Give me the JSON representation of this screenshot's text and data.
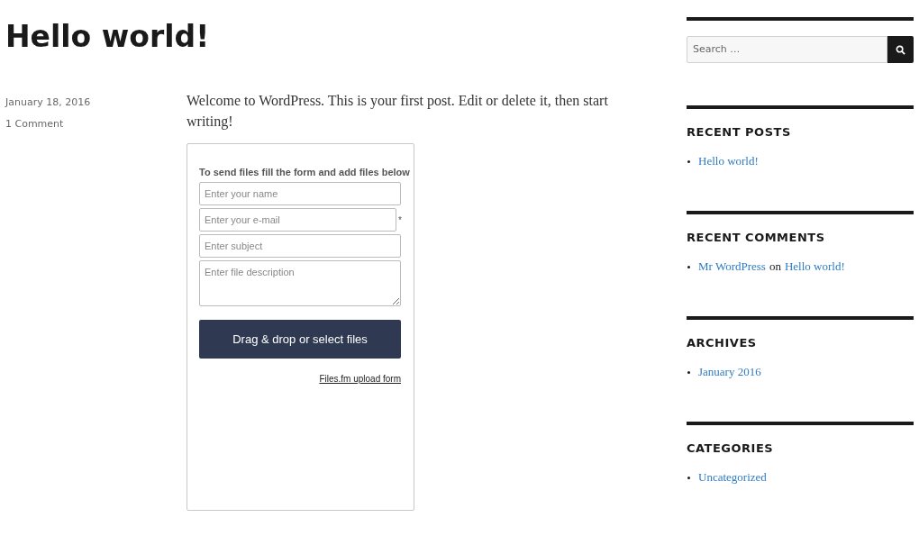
{
  "post": {
    "title": "Hello world!",
    "date": "January 18, 2016",
    "comments": "1 Comment",
    "body": "Welcome to WordPress. This is your first post. Edit or delete it, then start writing!"
  },
  "upload_form": {
    "heading": "To send files fill the form and add files below",
    "fields": [
      {
        "kind": "input",
        "placeholder": "Enter your name",
        "required": false
      },
      {
        "kind": "input",
        "placeholder": "Enter your e-mail",
        "required": true
      },
      {
        "kind": "input",
        "placeholder": "Enter subject",
        "required": false
      },
      {
        "kind": "textarea",
        "placeholder": "Enter file description",
        "required": false
      }
    ],
    "required_mark": "*",
    "button": "Drag & drop or select files",
    "footer_link": "Files.fm upload form"
  },
  "sidebar": {
    "search": {
      "placeholder": "Search …"
    },
    "widgets": [
      {
        "title": "RECENT POSTS",
        "items": [
          {
            "parts": [
              {
                "text": "Hello world!",
                "link": true
              }
            ]
          }
        ]
      },
      {
        "title": "RECENT COMMENTS",
        "items": [
          {
            "parts": [
              {
                "text": "Mr WordPress",
                "link": true
              },
              {
                "text": "on",
                "link": false
              },
              {
                "text": "Hello world!",
                "link": true
              }
            ]
          }
        ]
      },
      {
        "title": "ARCHIVES",
        "items": [
          {
            "parts": [
              {
                "text": "January 2016",
                "link": true
              }
            ]
          }
        ]
      },
      {
        "title": "CATEGORIES",
        "items": [
          {
            "parts": [
              {
                "text": "Uncategorized",
                "link": true
              }
            ]
          }
        ]
      }
    ]
  }
}
